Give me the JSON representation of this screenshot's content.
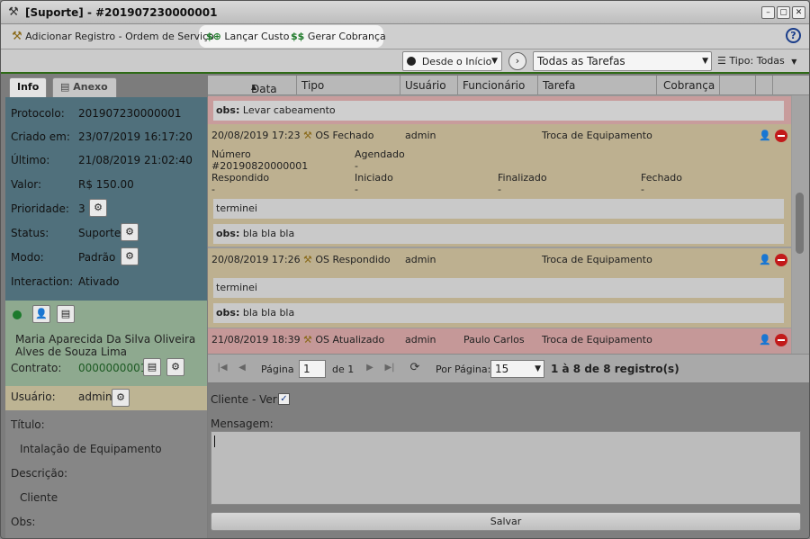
{
  "window": {
    "title": "[Suporte] - #201907230000001"
  },
  "toolbar": {
    "add_record": "Adicionar Registro - Ordem de Serviço",
    "launch_cost": "Lançar Custo",
    "generate_charge": "Gerar Cobrança",
    "help": "?"
  },
  "filters": {
    "since": "Desde o Início",
    "tasks": "Todas as Tarefas",
    "type": "Tipo: Todas"
  },
  "left_tabs": {
    "info": "Info",
    "attachment": "Anexo"
  },
  "info": {
    "protocol_label": "Protocolo:",
    "protocol": "201907230000001",
    "created_label": "Criado em:",
    "created": "23/07/2019 16:17:20",
    "last_label": "Último:",
    "last": "21/08/2019 21:02:40",
    "value_label": "Valor:",
    "value": "R$ 150.00",
    "priority_label": "Prioridade:",
    "priority": "3",
    "status_label": "Status:",
    "status": "Suporte",
    "mode_label": "Modo:",
    "mode": "Padrão",
    "interaction_label": "Interaction:",
    "interaction": "Ativado"
  },
  "client": {
    "name": "Maria Aparecida Da Silva Oliveira Alves de Souza Lima",
    "contract_label": "Contrato:",
    "contract": "0000000001",
    "user_label": "Usuário:",
    "user": "admin"
  },
  "details": {
    "title_label": "Título:",
    "title": "Intalação de Equipamento",
    "description_label": "Descrição:",
    "description": "Cliente",
    "obs_label": "Obs:"
  },
  "grid": {
    "columns": [
      "Data",
      "Tipo",
      "Usuário",
      "Funcionário",
      "Tarefa",
      "Cobrança"
    ],
    "obs_prefix": "obs:",
    "row0_obs": "Levar cabeamento",
    "row1": {
      "date": "20/08/2019 17:23",
      "type": "OS Fechado",
      "user": "admin",
      "employee": "",
      "task": "Troca de Equipamento"
    },
    "row1_details": {
      "numero_label": "Número",
      "numero": "#20190820000001",
      "agendado_label": "Agendado",
      "agendado": "-",
      "respondido_label": "Respondido",
      "respondido": "-",
      "iniciado_label": "Iniciado",
      "iniciado": "-",
      "finalizado_label": "Finalizado",
      "finalizado": "-",
      "fechado_label": "Fechado",
      "fechado": "-"
    },
    "row1_msg": "terminei",
    "row1_obs": "bla bla bla",
    "row2": {
      "date": "20/08/2019 17:26",
      "type": "OS Respondido",
      "user": "admin",
      "employee": "",
      "task": "Troca de Equipamento"
    },
    "row2_msg": "terminei",
    "row2_obs": "bla bla bla",
    "row3": {
      "date": "21/08/2019 18:39",
      "type": "OS Atualizado",
      "user": "admin",
      "employee": "Paulo Carlos",
      "task": "Troca de Equipamento"
    }
  },
  "pager": {
    "page_label": "Página",
    "page": "1",
    "of": "de 1",
    "per_page_label": "Por Página:",
    "per_page": "15",
    "summary": "1 à 8 de 8 registro(s)"
  },
  "form": {
    "client_view_label": "Cliente - Ver:",
    "message_label": "Mensagem:",
    "save": "Salvar"
  }
}
